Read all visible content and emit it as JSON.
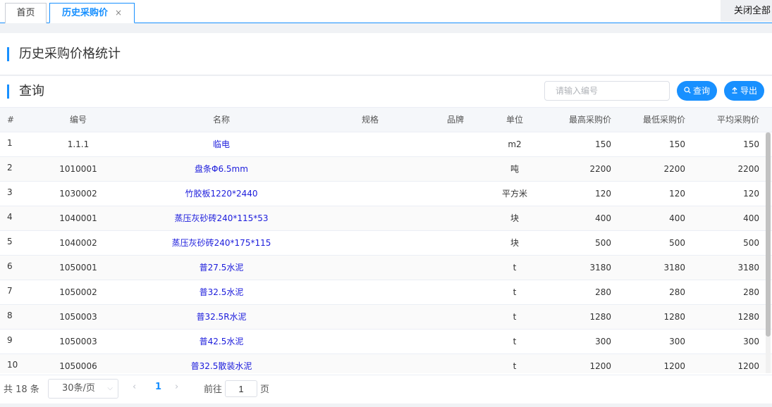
{
  "tabs": {
    "home_label": "首页",
    "active_label": "历史采购价",
    "close_symbol": "×",
    "close_all_label": "关闭全部"
  },
  "page_title": "历史采购价格统计",
  "query": {
    "section_title": "查询",
    "input_placeholder": "请输入编号",
    "search_label": "查询",
    "export_label": "导出"
  },
  "table": {
    "headers": {
      "idx": "#",
      "code": "编号",
      "name": "名称",
      "spec": "规格",
      "brand": "品牌",
      "unit": "单位",
      "max": "最高采购价",
      "min": "最低采购价",
      "avg": "平均采购价"
    },
    "rows": [
      {
        "idx": "1",
        "code": "1.1.1",
        "name": "临电",
        "spec": "",
        "brand": "",
        "unit": "m2",
        "max": "150",
        "min": "150",
        "avg": "150"
      },
      {
        "idx": "2",
        "code": "1010001",
        "name": "盘条Φ6.5mm",
        "spec": "",
        "brand": "",
        "unit": "吨",
        "max": "2200",
        "min": "2200",
        "avg": "2200"
      },
      {
        "idx": "3",
        "code": "1030002",
        "name": "竹胶板1220*2440",
        "spec": "",
        "brand": "",
        "unit": "平方米",
        "max": "120",
        "min": "120",
        "avg": "120"
      },
      {
        "idx": "4",
        "code": "1040001",
        "name": "蒸压灰砂砖240*115*53",
        "spec": "",
        "brand": "",
        "unit": "块",
        "max": "400",
        "min": "400",
        "avg": "400"
      },
      {
        "idx": "5",
        "code": "1040002",
        "name": "蒸压灰砂砖240*175*115",
        "spec": "",
        "brand": "",
        "unit": "块",
        "max": "500",
        "min": "500",
        "avg": "500"
      },
      {
        "idx": "6",
        "code": "1050001",
        "name": "普27.5水泥",
        "spec": "",
        "brand": "",
        "unit": "t",
        "max": "3180",
        "min": "3180",
        "avg": "3180"
      },
      {
        "idx": "7",
        "code": "1050002",
        "name": "普32.5水泥",
        "spec": "",
        "brand": "",
        "unit": "t",
        "max": "280",
        "min": "280",
        "avg": "280"
      },
      {
        "idx": "8",
        "code": "1050003",
        "name": "普32.5R水泥",
        "spec": "",
        "brand": "",
        "unit": "t",
        "max": "1280",
        "min": "1280",
        "avg": "1280"
      },
      {
        "idx": "9",
        "code": "1050003",
        "name": "普42.5水泥",
        "spec": "",
        "brand": "",
        "unit": "t",
        "max": "300",
        "min": "300",
        "avg": "300"
      },
      {
        "idx": "10",
        "code": "1050006",
        "name": "普32.5散装水泥",
        "spec": "",
        "brand": "",
        "unit": "t",
        "max": "1200",
        "min": "1200",
        "avg": "1200"
      }
    ]
  },
  "pagination": {
    "total_label": "共 18 条",
    "page_size": "30条/页",
    "prev_symbol": "‹",
    "current_page": "1",
    "next_symbol": "›",
    "goto_label": "前往",
    "goto_value": "1",
    "goto_suffix": "页"
  },
  "colors": {
    "accent": "#1890ff",
    "link": "#1c1cdc"
  }
}
